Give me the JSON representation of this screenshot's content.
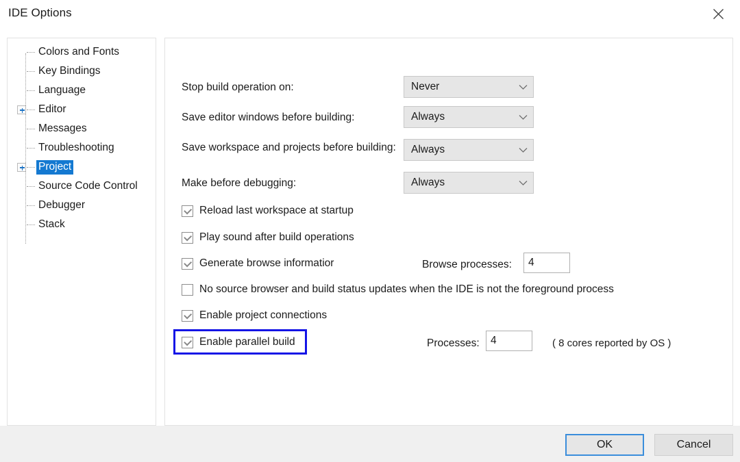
{
  "window": {
    "title": "IDE Options",
    "close_icon": "close-icon"
  },
  "sidebar": {
    "items": [
      {
        "label": "Colors and Fonts",
        "expandable": false,
        "selected": false
      },
      {
        "label": "Key Bindings",
        "expandable": false,
        "selected": false
      },
      {
        "label": "Language",
        "expandable": false,
        "selected": false
      },
      {
        "label": "Editor",
        "expandable": true,
        "selected": false
      },
      {
        "label": "Messages",
        "expandable": false,
        "selected": false
      },
      {
        "label": "Troubleshooting",
        "expandable": false,
        "selected": false
      },
      {
        "label": "Project",
        "expandable": true,
        "selected": true
      },
      {
        "label": "Source Code Control",
        "expandable": false,
        "selected": false
      },
      {
        "label": "Debugger",
        "expandable": false,
        "selected": false
      },
      {
        "label": "Stack",
        "expandable": false,
        "selected": false
      }
    ]
  },
  "main": {
    "dropdowns": [
      {
        "label": "Stop build operation on:",
        "value": "Never"
      },
      {
        "label": "Save editor windows before building:",
        "value": "Always"
      },
      {
        "label": "Save workspace and projects before building:",
        "value": "Always"
      },
      {
        "label": "Make before debugging:",
        "value": "Always"
      }
    ],
    "checkboxes": [
      {
        "label": "Reload last workspace at startup",
        "checked": true
      },
      {
        "label": "Play sound after build operations",
        "checked": true
      },
      {
        "label": "Generate browse informatior",
        "checked": true
      },
      {
        "label": "No source browser and build status updates when the IDE is not the foreground process",
        "checked": false
      },
      {
        "label": "Enable project connections",
        "checked": true
      },
      {
        "label": "Enable parallel build",
        "checked": true
      }
    ],
    "browse_processes": {
      "label": "Browse processes:",
      "value": "4"
    },
    "processes": {
      "label": "Processes:",
      "value": "4"
    },
    "cores_note": "( 8 cores reported by OS )"
  },
  "footer": {
    "ok_label": "OK",
    "cancel_label": "Cancel"
  },
  "colors": {
    "selection_blue": "#1479d1",
    "highlight_blue": "#1414e6",
    "focus_blue": "#3a8ddb",
    "panel_border": "#e2e2e2",
    "dropdown_bg": "#e6e6e6",
    "footer_bg": "#f0f0f0"
  }
}
